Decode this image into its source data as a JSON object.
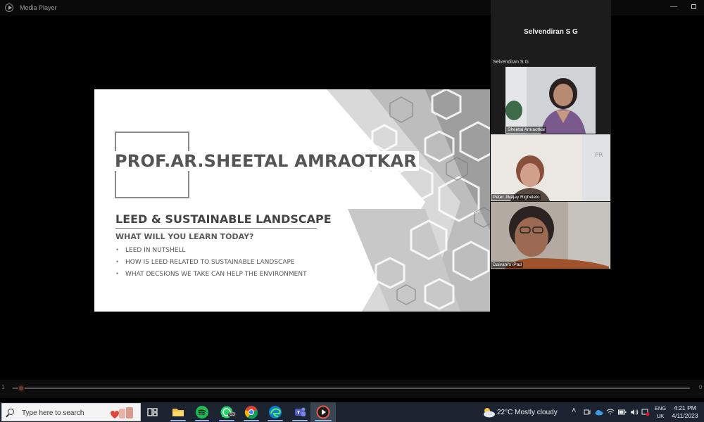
{
  "window": {
    "title": "Media Player",
    "minimize_glyph": "—"
  },
  "slide": {
    "presenter": "PROF.AR.SHEETAL AMRAOTKAR",
    "course_title": "LEED & SUSTAINABLE LANDSCAPE",
    "learn_title": "WHAT WILL YOU LEARN TODAY?",
    "bullet_char": "•",
    "bullets": [
      "LEED IN NUTSHELL",
      "HOW IS LEED RELATED TO SUSTAINABLE LANDSCAPE",
      "WHAT DECSIONS WE TAKE CAN HELP THE ENVIRONMENT"
    ]
  },
  "meeting": {
    "presenter_banner": "Selvendiran S G",
    "presenter_label": "Selvendiran S G",
    "participants": [
      {
        "name": "Sheetal Amraotkar"
      },
      {
        "name": "Peter Jikajay Righeleto"
      },
      {
        "name": "Daivani's iPad"
      }
    ]
  },
  "playback": {
    "start_label": "1",
    "end_label": "0",
    "progress": 0.012
  },
  "taskbar": {
    "search_placeholder": "Type here to search",
    "whatsapp_badge": "63",
    "weather": "22°C  Mostly cloudy",
    "language_line1": "ENG",
    "language_line2": "UK",
    "time": "4:21 PM",
    "date": "4/11/2023",
    "icons": [
      "task-view-icon",
      "file-explorer-icon",
      "spotify-icon",
      "whatsapp-icon",
      "chrome-icon",
      "edge-icon",
      "teams-icon",
      "media-player-icon"
    ]
  },
  "colors": {
    "taskbar": "#1b2430",
    "slide_text": "#555555",
    "spotify": "#1db954",
    "whatsapp": "#25d366",
    "accent_underline": "#8fb4e0"
  }
}
